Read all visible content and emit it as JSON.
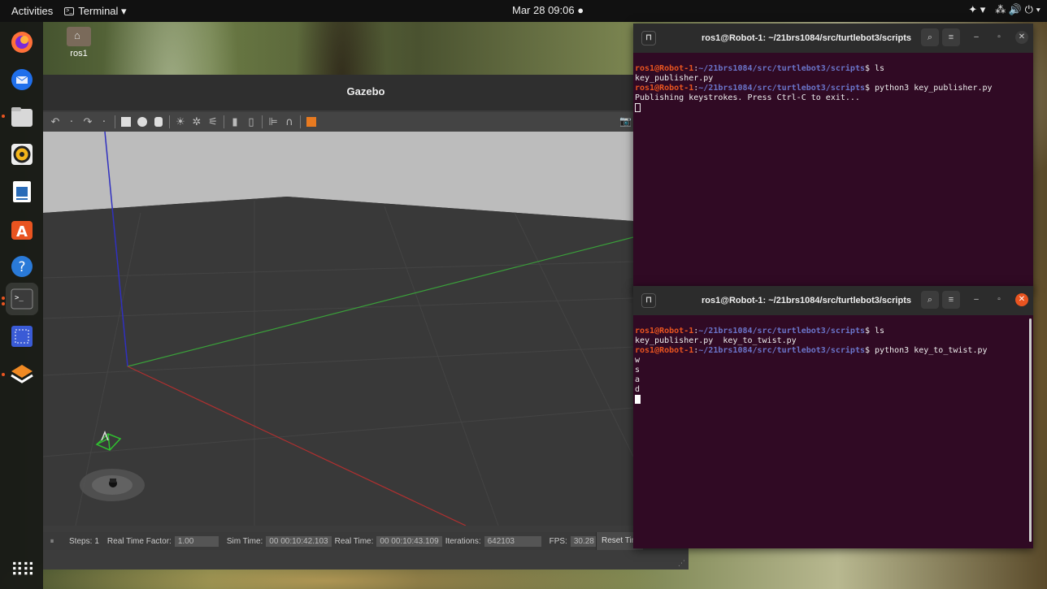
{
  "topbar": {
    "activities": "Activities",
    "app_name": "Terminal ▾",
    "clock": "Mar 28  09:06  ●",
    "tray": [
      "✦ ▾",
      "⁂ 🔊 ⏻ ▾"
    ]
  },
  "dock": {
    "items": [
      "firefox-icon",
      "thunderbird-icon",
      "files-icon",
      "rhythmbox-icon",
      "libreoffice-writer-icon",
      "software-center-icon",
      "help-icon",
      "terminal-icon",
      "screenshot-icon",
      "layers-icon"
    ],
    "apps_grid": "⠿⠿"
  },
  "desktop": {
    "home_label": "ros1"
  },
  "gazebo": {
    "title": "Gazebo",
    "bottom": {
      "pause": "⏸",
      "steps_label": "Steps:",
      "steps_value": "1",
      "rtf_label": "Real Time Factor:",
      "rtf_value": "1.00",
      "sim_label": "Sim Time:",
      "sim_value": "00 00:10:42.103",
      "real_label": "Real Time:",
      "real_value": "00 00:10:43.109",
      "iter_label": "Iterations:",
      "iter_value": "642103",
      "fps_label": "FPS:",
      "fps_value": "30.28",
      "reset": "Reset Tim"
    }
  },
  "terminal1": {
    "title": "ros1@Robot-1: ~/21brs1084/src/turtlebot3/scripts",
    "user_host": "ros1@Robot-1",
    "path": "~/21brs1084/src/turtlebot3/scripts",
    "lines": [
      {
        "cmd": " ls"
      },
      {
        "out": "key_publisher.py"
      },
      {
        "cmd": " python3 key_publisher.py"
      },
      {
        "out": "Publishing keystrokes. Press Ctrl-C to exit..."
      }
    ]
  },
  "terminal2": {
    "title": "ros1@Robot-1: ~/21brs1084/src/turtlebot3/scripts",
    "user_host": "ros1@Robot-1",
    "path": "~/21brs1084/src/turtlebot3/scripts",
    "lines": [
      {
        "cmd": " ls"
      },
      {
        "out": "key_publisher.py  key_to_twist.py"
      },
      {
        "cmd": " python3 key_to_twist.py"
      },
      {
        "out": "w"
      },
      {
        "out": "s"
      },
      {
        "out": "a"
      },
      {
        "out": "d"
      }
    ]
  },
  "colors": {
    "terminal_bg": "#300a24",
    "prompt_user": "#e95420",
    "prompt_path": "#6a74c9",
    "x_axis": "#b03030",
    "y_axis": "#3aa03a",
    "z_axis": "#3030c0"
  }
}
